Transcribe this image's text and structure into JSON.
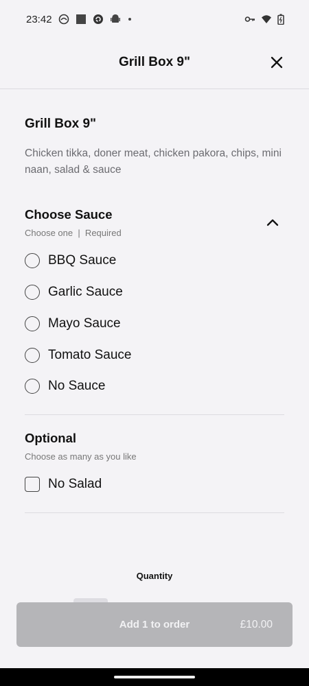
{
  "status_bar": {
    "time": "23:42",
    "left_icons": [
      "app-icon",
      "square-icon",
      "sync-icon",
      "android-icon",
      "dot-icon"
    ],
    "right_icons": [
      "key-icon",
      "wifi-icon",
      "battery-icon"
    ]
  },
  "header": {
    "title": "Grill Box 9\"",
    "close_icon": "close-icon"
  },
  "item": {
    "title": "Grill Box 9\"",
    "description": "Chicken tikka, doner meat, chicken pakora, chips, mini naan, salad & sauce"
  },
  "sauce_section": {
    "title": "Choose Sauce",
    "subtitle": "Choose one  |  Required",
    "expanded_icon": "chevron-up-icon",
    "options": [
      {
        "label": "BBQ Sauce",
        "selected": false
      },
      {
        "label": "Garlic Sauce",
        "selected": false
      },
      {
        "label": "Mayo Sauce",
        "selected": false
      },
      {
        "label": "Tomato Sauce",
        "selected": false
      },
      {
        "label": "No Sauce",
        "selected": false
      }
    ]
  },
  "optional_section": {
    "title": "Optional",
    "subtitle": "Choose as many as you like",
    "options": [
      {
        "label": "No Salad",
        "checked": false
      }
    ]
  },
  "quantity": {
    "label": "Quantity"
  },
  "order_button": {
    "label": "Add 1 to order",
    "price": "£10.00",
    "enabled": false
  },
  "colors": {
    "background": "#f4f3f6",
    "button_disabled": "#b5b5b8",
    "divider": "#dcdbe0",
    "text_secondary": "#6b6b70"
  }
}
